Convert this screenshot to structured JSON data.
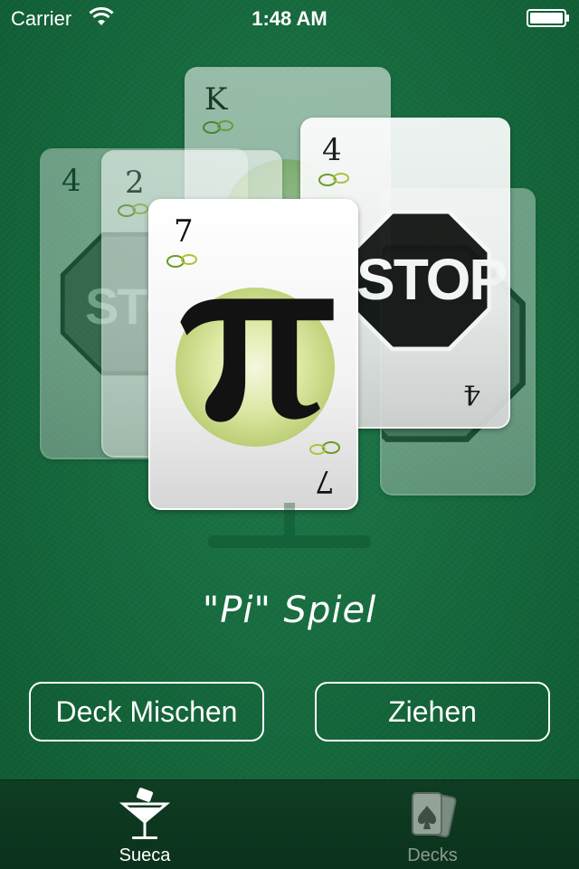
{
  "status_bar": {
    "carrier": "Carrier",
    "time": "1:48 AM"
  },
  "cards": {
    "back_left_rank": "4",
    "mid_left_rank": "2",
    "top_back_rank": "K",
    "right_rank": "4",
    "front_rank": "7",
    "stop_label": "STOP"
  },
  "game": {
    "title": "\"Pi\" Spiel"
  },
  "buttons": {
    "shuffle_label": "Deck Mischen",
    "draw_label": "Ziehen"
  },
  "tabbar": {
    "tabs": [
      {
        "label": "Sueca",
        "icon": "cocktail-glass-icon",
        "selected": true
      },
      {
        "label": "Decks",
        "icon": "playing-cards-icon",
        "selected": false
      }
    ]
  },
  "colors": {
    "felt": "#176b3f",
    "tabbar": "#0f3d23",
    "tab_inactive": "#8a9a8f",
    "stop_red": "#111111"
  }
}
